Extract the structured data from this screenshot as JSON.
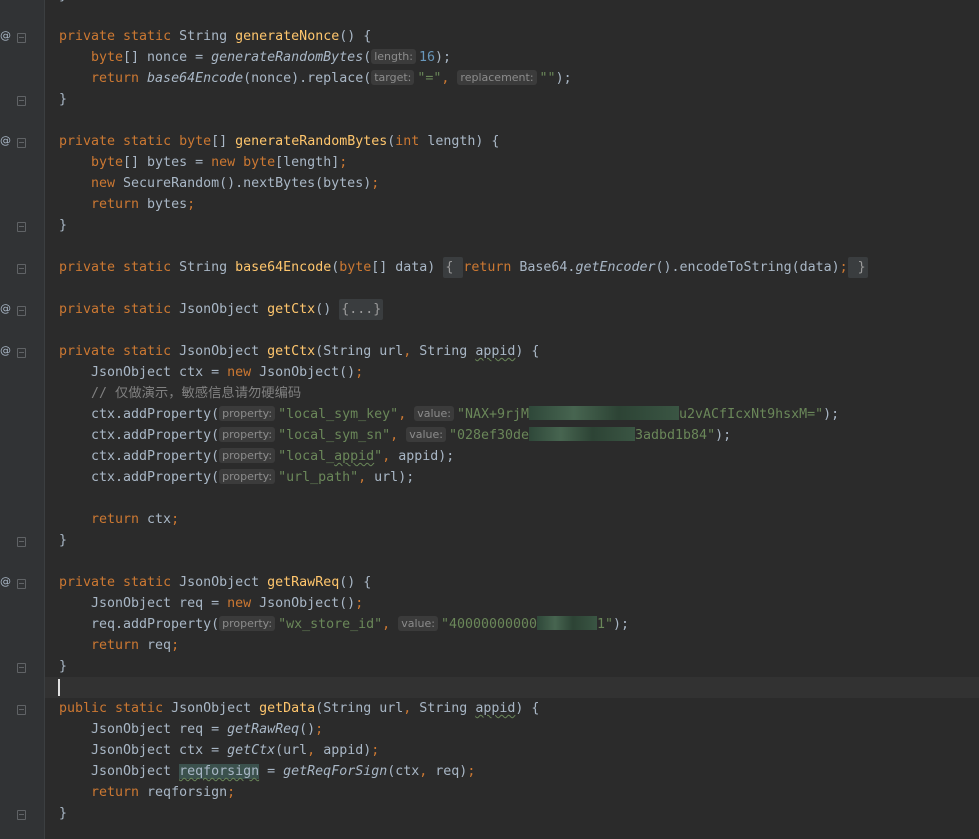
{
  "editor": {
    "lines": {
      "l0": {
        "a": "private static ",
        "b": "String ",
        "c": "generateNonce",
        "d": "() {"
      },
      "l1": {
        "a": "byte",
        "b": "[] nonce = ",
        "c": "generateRandomBytes",
        "d": "(",
        "hint": "length:",
        "e": "16",
        "f": ");"
      },
      "l2": {
        "a": "return ",
        "b": "base64Encode",
        "c": "(nonce).replace(",
        "h1": "target:",
        "s1": "\"=\"",
        "sep": ", ",
        "h2": "replacement:",
        "s2": "\"\"",
        "end": ");"
      },
      "l3": {
        "a": "}"
      },
      "l4": {
        "a": "private static ",
        "b": "byte",
        "c": "[] ",
        "d": "generateRandomBytes",
        "e": "(",
        "f": "int ",
        "g": "length) {"
      },
      "l5": {
        "a": "byte",
        "b": "[] bytes = ",
        "c": "new ",
        "d": "byte",
        "e": "[length]",
        ";": ";"
      },
      "l6": {
        "a": "new ",
        "b": "SecureRandom().nextBytes(bytes)",
        ";": ";"
      },
      "l7": {
        "a": "return ",
        "b": "bytes",
        ";": ";"
      },
      "l8": {
        "a": "}"
      },
      "l9": {
        "a": "private static ",
        "b": "String ",
        "c": "base64Encode",
        "d": "(",
        "e": "byte",
        "f": "[] data) ",
        "g": "{ ",
        "h": "return ",
        "i": "Base64.",
        "j": "getEncoder",
        "k": "().encodeToString(data)",
        ";": ";",
        "l": " }"
      },
      "l10": {
        "a": "private static ",
        "b": "JsonObject ",
        "c": "getCtx",
        "d": "() ",
        "e": "{...}"
      },
      "l11": {
        "a": "private static ",
        "b": "JsonObject ",
        "c": "getCtx",
        "d": "(String url",
        ",": ", ",
        "e": "String ",
        "f": "appid",
        ")": ") {"
      },
      "l12": {
        "a": "JsonObject ctx = ",
        "b": "new ",
        "c": "JsonObject()",
        ";": ";"
      },
      "l13": {
        "a": "// 仅做演示，敏感信息请勿硬编码"
      },
      "l14": {
        "a": "ctx.addProperty(",
        "h1": "property:",
        "s1": "\"local_sym_key\"",
        ",": ", ",
        "h2": "value:",
        "s2a": "\"NAX+9rjM",
        "s2b": "u2vACfIcxNt9hsxM=\"",
        "end": ");"
      },
      "l15": {
        "a": "ctx.addProperty(",
        "h1": "property:",
        "s1": "\"local_sym_sn\"",
        ",": ", ",
        "h2": "value:",
        "s2a": "\"028ef30de",
        "s2b": "3adbd1b84\"",
        "end": ");"
      },
      "l16": {
        "a": "ctx.addProperty(",
        "h1": "property:",
        "s1a": "\"local_",
        "s1b": "appid",
        "s1c": "\"",
        ",": ", ",
        "b": "appid);"
      },
      "l17": {
        "a": "ctx.addProperty(",
        "h1": "property:",
        "s1": "\"url_path\"",
        ",": ", ",
        "b": "url);"
      },
      "l18": {
        "a": "return ",
        "b": "ctx",
        ";": ";"
      },
      "l19": {
        "a": "}"
      },
      "l20": {
        "a": "private static ",
        "b": "JsonObject ",
        "c": "getRawReq",
        "d": "() {"
      },
      "l21": {
        "a": "JsonObject req = ",
        "b": "new ",
        "c": "JsonObject()",
        ";": ";"
      },
      "l22": {
        "a": "req.addProperty(",
        "h1": "property:",
        "s1": "\"wx_store_id\"",
        ",": ", ",
        "h2": "value:",
        "s2a": "\"40000000000",
        "s2b": "1\"",
        "end": ");"
      },
      "l23": {
        "a": "return ",
        "b": "req",
        ";": ";"
      },
      "l24": {
        "a": "}"
      },
      "l25": {
        "a": "public static ",
        "b": "JsonObject ",
        "c": "getData",
        "d": "(String url",
        ",": ", ",
        "e": "String ",
        "f": "appid",
        ")": ") {"
      },
      "l26": {
        "a": "JsonObject req = ",
        "b": "getRawReq",
        "c": "()",
        ";": ";"
      },
      "l27": {
        "a": "JsonObject ctx = ",
        "b": "getCtx",
        "c": "(url",
        ",": ", ",
        "d": "appid)",
        ";2": ";"
      },
      "l28": {
        "a": "JsonObject ",
        "b": "reqforsign",
        "c": " = ",
        "d": "getReqForSign",
        "e": "(ctx",
        ",": ", ",
        "f": "req)",
        ";": ";"
      },
      "l29": {
        "a": "return ",
        "b": "reqforsign",
        ";": ";"
      },
      "l30": {
        "a": "}"
      },
      "l_top": {
        "a": "}"
      }
    },
    "gutter_marker": "@"
  }
}
